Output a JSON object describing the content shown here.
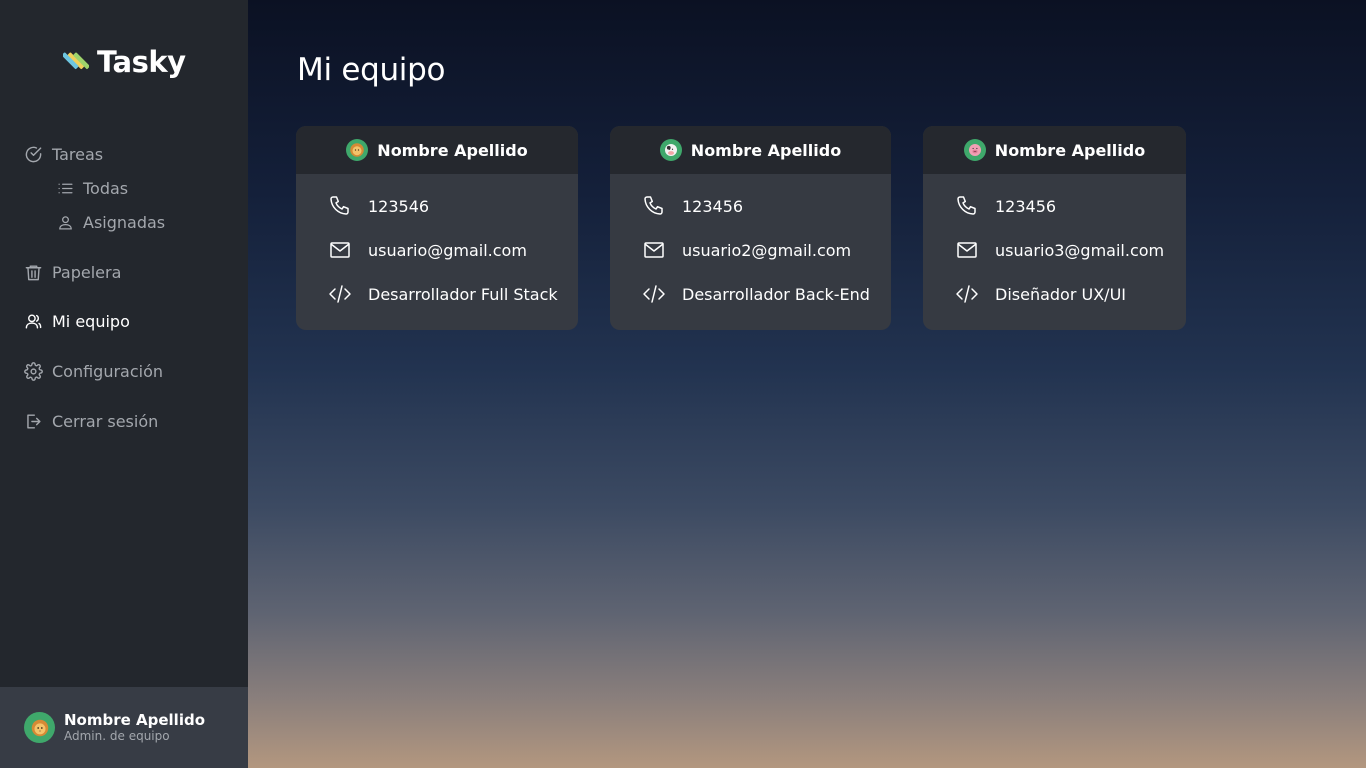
{
  "app": {
    "name": "Tasky"
  },
  "sidebar": {
    "tasks": "Tareas",
    "all": "Todas",
    "assigned": "Asignadas",
    "trash": "Papelera",
    "team": "Mi equipo",
    "settings": "Configuración",
    "logout": "Cerrar sesión"
  },
  "profile": {
    "name": "Nombre Apellido",
    "role": "Admin. de equipo"
  },
  "main": {
    "title": "Mi equipo"
  },
  "members": [
    {
      "name": "Nombre Apellido",
      "phone": "123546",
      "email": "usuario@gmail.com",
      "role": "Desarrollador Full Stack",
      "avatar": "lion-avatar"
    },
    {
      "name": "Nombre Apellido",
      "phone": "123456",
      "email": "usuario2@gmail.com",
      "role": "Desarrollador Back-End",
      "avatar": "cow-avatar"
    },
    {
      "name": "Nombre Apellido",
      "phone": "123456",
      "email": "usuario3@gmail.com",
      "role": "Diseñador UX/UI",
      "avatar": "pig-avatar"
    }
  ],
  "colors": {
    "sidebar": "#23272d",
    "card": "#363a42",
    "card_header": "#25282e",
    "avatar_bg": "#3fa86b"
  }
}
